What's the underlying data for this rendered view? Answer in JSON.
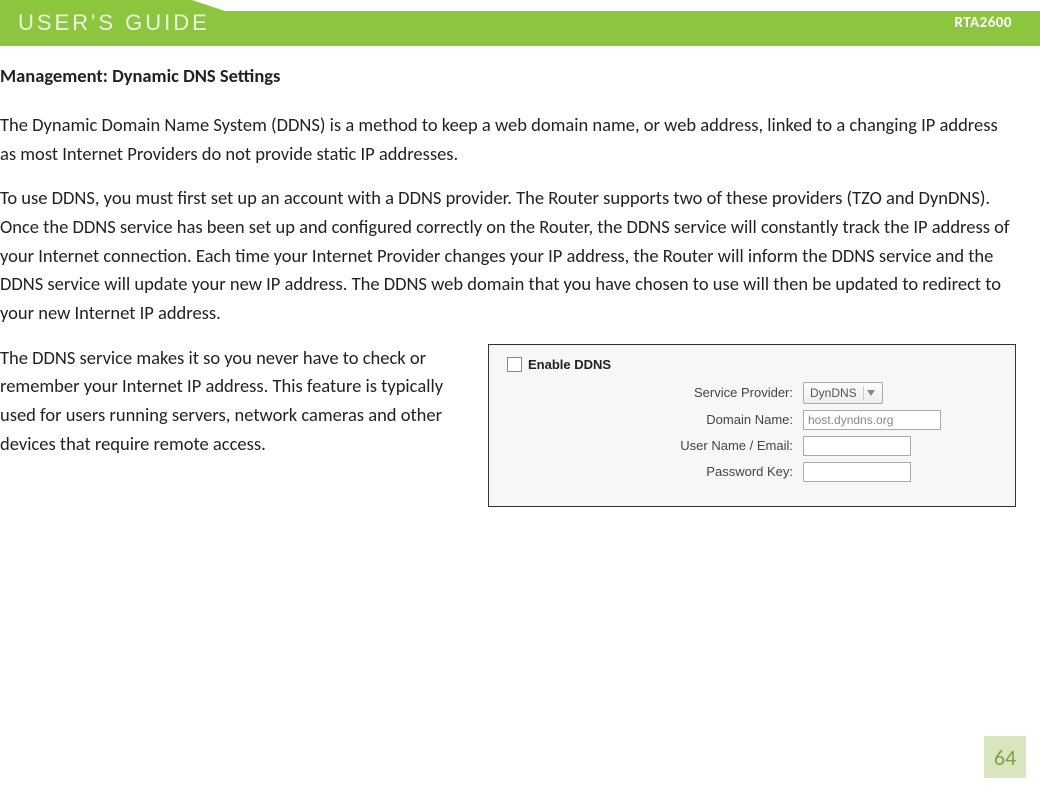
{
  "header": {
    "title": "USER'S GUIDE",
    "model": "RTA2600"
  },
  "page": {
    "heading": "Management: Dynamic DNS Settings",
    "p1": "The Dynamic Domain Name System (DDNS) is a method to keep a web domain name, or web address, linked to a changing IP address as most Internet Providers do not provide static IP addresses.",
    "p2": "To use DDNS, you must first set up an account with a DDNS provider. The Router supports two of these providers (TZO and DynDNS). Once the DDNS service has been set up and configured correctly on the Router, the DDNS service will constantly track the IP address of your Internet connection. Each time your Internet Provider changes your IP address, the Router will inform the DDNS service and the DDNS service will update your new IP address.  The DDNS web domain that you have chosen to use will then be updated to redirect to your new Internet IP address.",
    "p3": "The DDNS service makes it so you never have to check or remember your Internet IP address. This feature is typically used for users running servers, network cameras and other devices that require remote access.",
    "number": "64"
  },
  "form": {
    "enable_label": "Enable DDNS",
    "rows": {
      "provider": {
        "label": "Service Provider:",
        "value": "DynDNS"
      },
      "domain": {
        "label": "Domain Name:",
        "value": "host.dyndns.org"
      },
      "user": {
        "label": "User Name / Email:",
        "value": ""
      },
      "password": {
        "label": "Password Key:",
        "value": ""
      }
    }
  }
}
